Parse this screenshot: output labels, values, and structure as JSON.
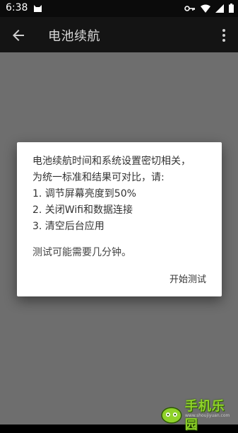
{
  "status_bar": {
    "time": "6:38"
  },
  "app_bar": {
    "title": "电池续航"
  },
  "dialog": {
    "message_lines": [
      "电池续航时间和系统设置密切相关，",
      "为统一标准和结果可对比，请:",
      "1. 调节屏幕亮度到50%",
      "2. 关闭Wifi和数据连接",
      "3. 清空后台应用"
    ],
    "note": "测试可能需要几分钟。",
    "action_label": "开始测试"
  },
  "watermark": {
    "text": "手机乐园",
    "sub": "www.shoujiyuan.com"
  },
  "colors": {
    "status_bar": "#0b0b0b",
    "app_bar": "#141414",
    "content_dim": "#6e6e6e",
    "dialog_bg": "#ffffff",
    "watermark_green": "#8fd22a"
  },
  "icons": [
    "cat-notification-icon",
    "vpn-key-icon",
    "wifi-icon",
    "signal-icon",
    "battery-icon",
    "back-arrow-icon",
    "overflow-menu-icon"
  ]
}
